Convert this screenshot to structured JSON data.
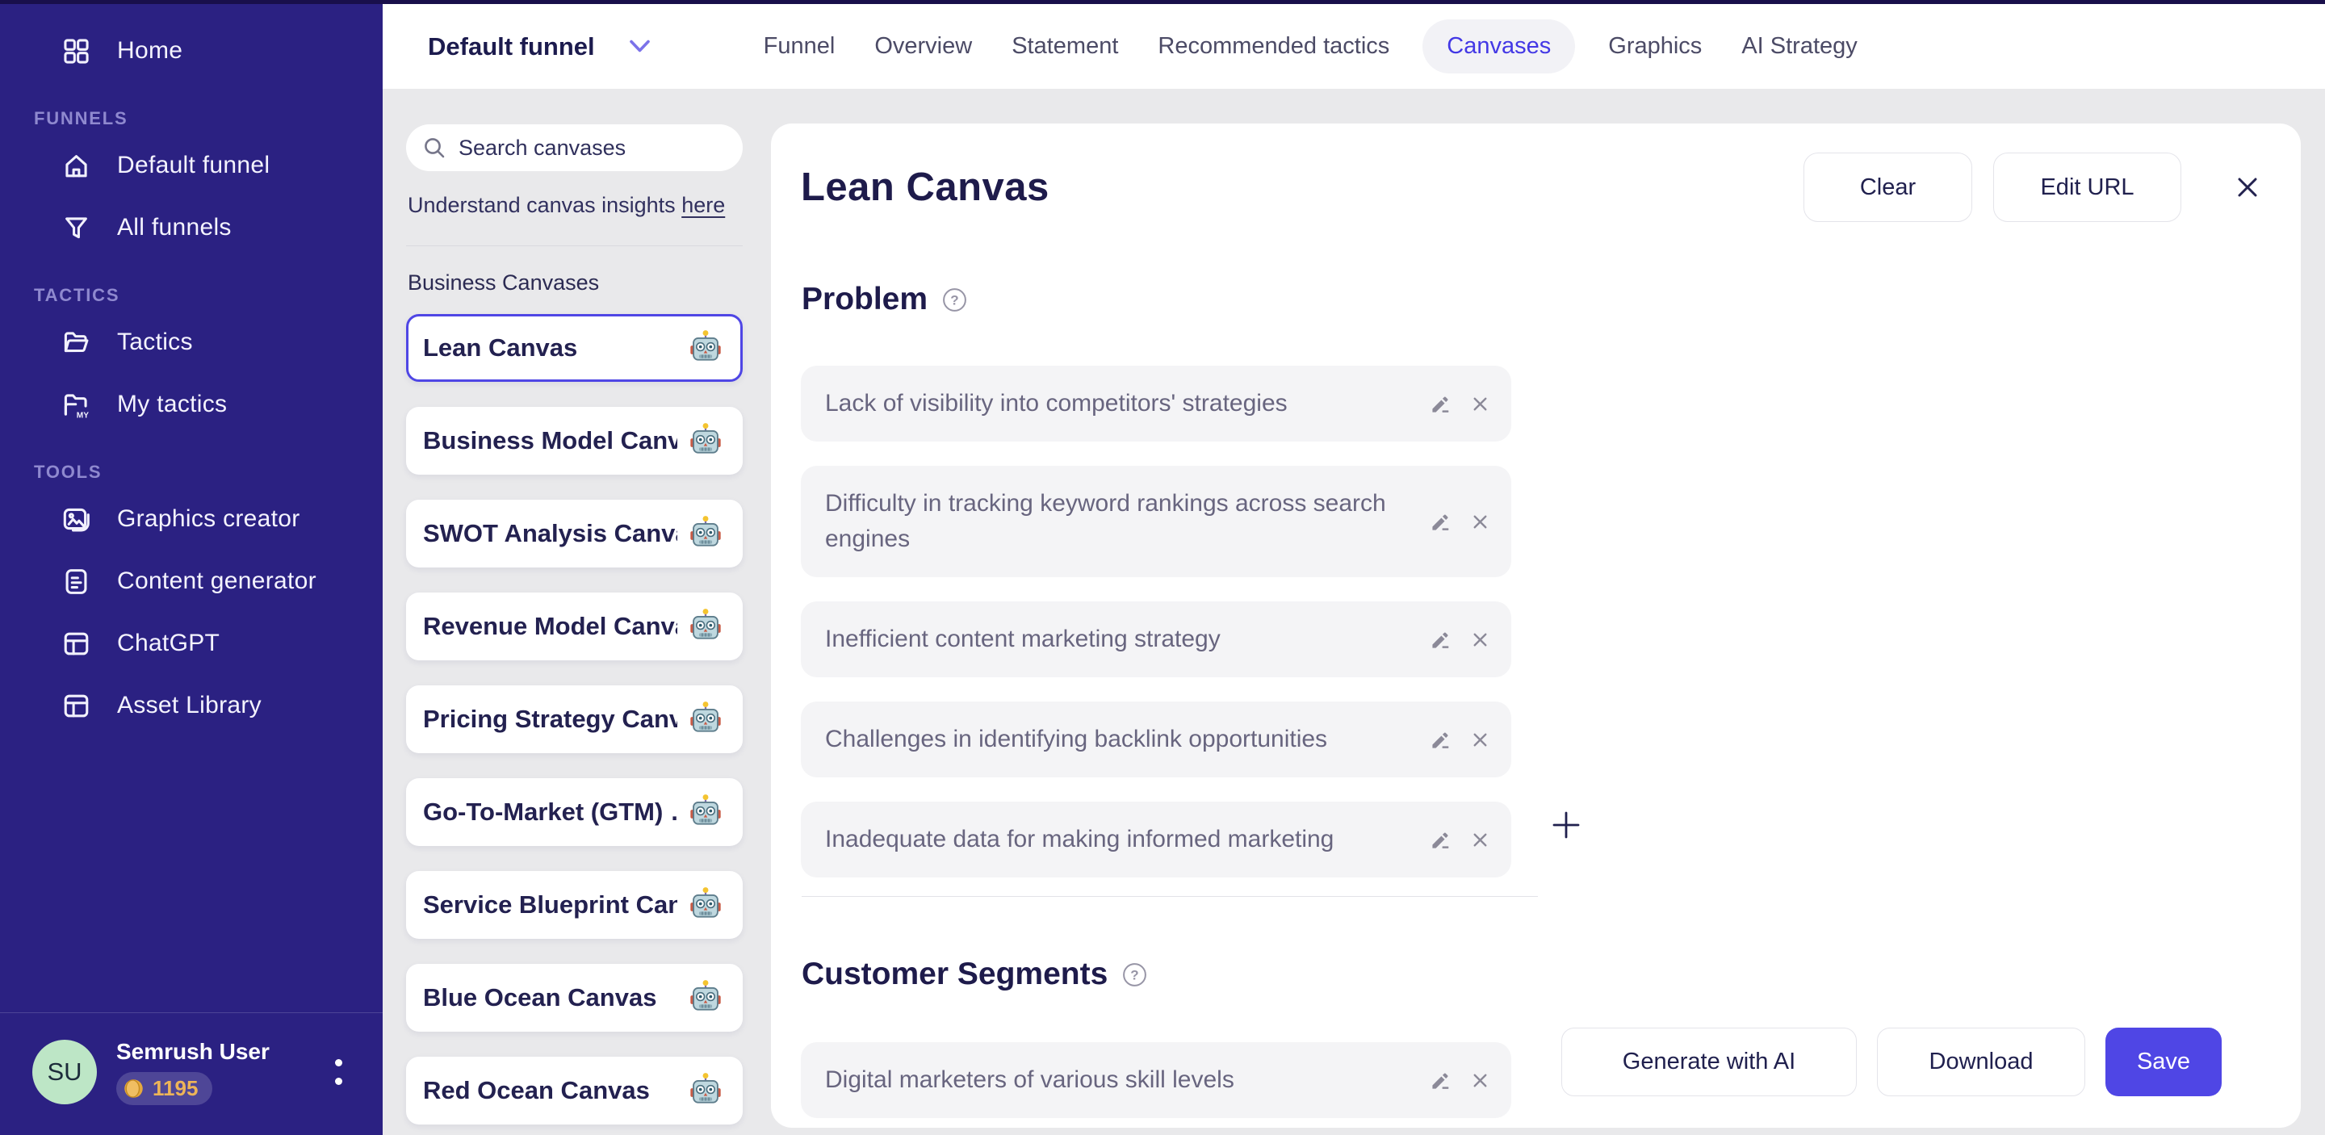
{
  "colors": {
    "accent": "#4F46E5",
    "sidebar_bg": "#2B2182",
    "top_strip": "#190F4B",
    "page_bg": "#E9E9EB",
    "panel_bg": "#FFFFFF",
    "entry_bg": "#F4F4F6",
    "heading_text": "#1E1B4B",
    "entry_text": "#68657F",
    "section_label": "#8F89CF",
    "avatar_bg": "#BDE6C6",
    "coin_text": "#EDB458",
    "active_tab_text": "#4338E5",
    "active_tab_bg": "#F2F2F6"
  },
  "icons": {
    "home": "grid-icon",
    "default_funnel": "house-icon",
    "all_funnels": "funnel-icon",
    "tactics": "folder-open-icon",
    "my_tactics": "folder-my-icon",
    "graphics_creator": "image-icon",
    "content_generator": "document-icon",
    "chatgpt": "window-icon",
    "asset_library": "window-icon",
    "funnel_dropdown": "chevron-down-icon",
    "search": "magnifier-icon",
    "canvas_item": "robot-icon",
    "section_help": "question-circle-icon",
    "entry_edit": "pencil-icon",
    "entry_remove": "x-icon",
    "add_entry": "plus-icon",
    "panel_close": "x-icon",
    "coins": "coin-icon",
    "user_menu": "vertical-dots-icon"
  },
  "sidebar": {
    "home": {
      "label": "Home"
    },
    "sections": [
      {
        "label": "FUNNELS",
        "items": [
          {
            "label": "Default funnel"
          },
          {
            "label": "All funnels"
          }
        ]
      },
      {
        "label": "TACTICS",
        "items": [
          {
            "label": "Tactics"
          },
          {
            "label": "My tactics"
          }
        ]
      },
      {
        "label": "TOOLS",
        "items": [
          {
            "label": "Graphics creator"
          },
          {
            "label": "Content generator"
          },
          {
            "label": "ChatGPT"
          },
          {
            "label": "Asset Library"
          }
        ]
      }
    ],
    "user": {
      "initials": "SU",
      "name": "Semrush User",
      "coins": "1195"
    }
  },
  "topbar": {
    "funnel_selector": "Default funnel",
    "tabs": [
      {
        "label": "Funnel"
      },
      {
        "label": "Overview"
      },
      {
        "label": "Statement"
      },
      {
        "label": "Recommended tactics"
      },
      {
        "label": "Canvases",
        "active": true
      },
      {
        "label": "Graphics"
      },
      {
        "label": "AI Strategy"
      }
    ]
  },
  "canvas_sidebar": {
    "search_placeholder": "Search canvases",
    "insights_text": "Understand canvas insights",
    "insights_link_label": "here",
    "group_label": "Business Canvases",
    "items": [
      {
        "label": "Lean Canvas",
        "selected": true
      },
      {
        "label": "Business Model Canvas"
      },
      {
        "label": "SWOT Analysis Canvas"
      },
      {
        "label": "Revenue Model Canvas"
      },
      {
        "label": "Pricing Strategy Canv…"
      },
      {
        "label": "Go-To-Market (GTM) …"
      },
      {
        "label": "Service Blueprint Can…"
      },
      {
        "label": "Blue Ocean Canvas"
      },
      {
        "label": "Red Ocean Canvas"
      }
    ]
  },
  "panel": {
    "title": "Lean Canvas",
    "actions": {
      "clear": "Clear",
      "edit_url": "Edit URL"
    },
    "sections": [
      {
        "title": "Problem",
        "entries": [
          "Lack of visibility into competitors' strategies",
          "Difficulty in tracking keyword rankings across search engines",
          "Inefficient content marketing strategy",
          "Challenges in identifying backlink opportunities",
          "Inadequate data for making informed marketing"
        ]
      },
      {
        "title": "Customer Segments",
        "entries": [
          "Digital marketers of various skill levels"
        ]
      }
    ],
    "footer": {
      "generate": "Generate with AI",
      "download": "Download",
      "save": "Save"
    }
  }
}
